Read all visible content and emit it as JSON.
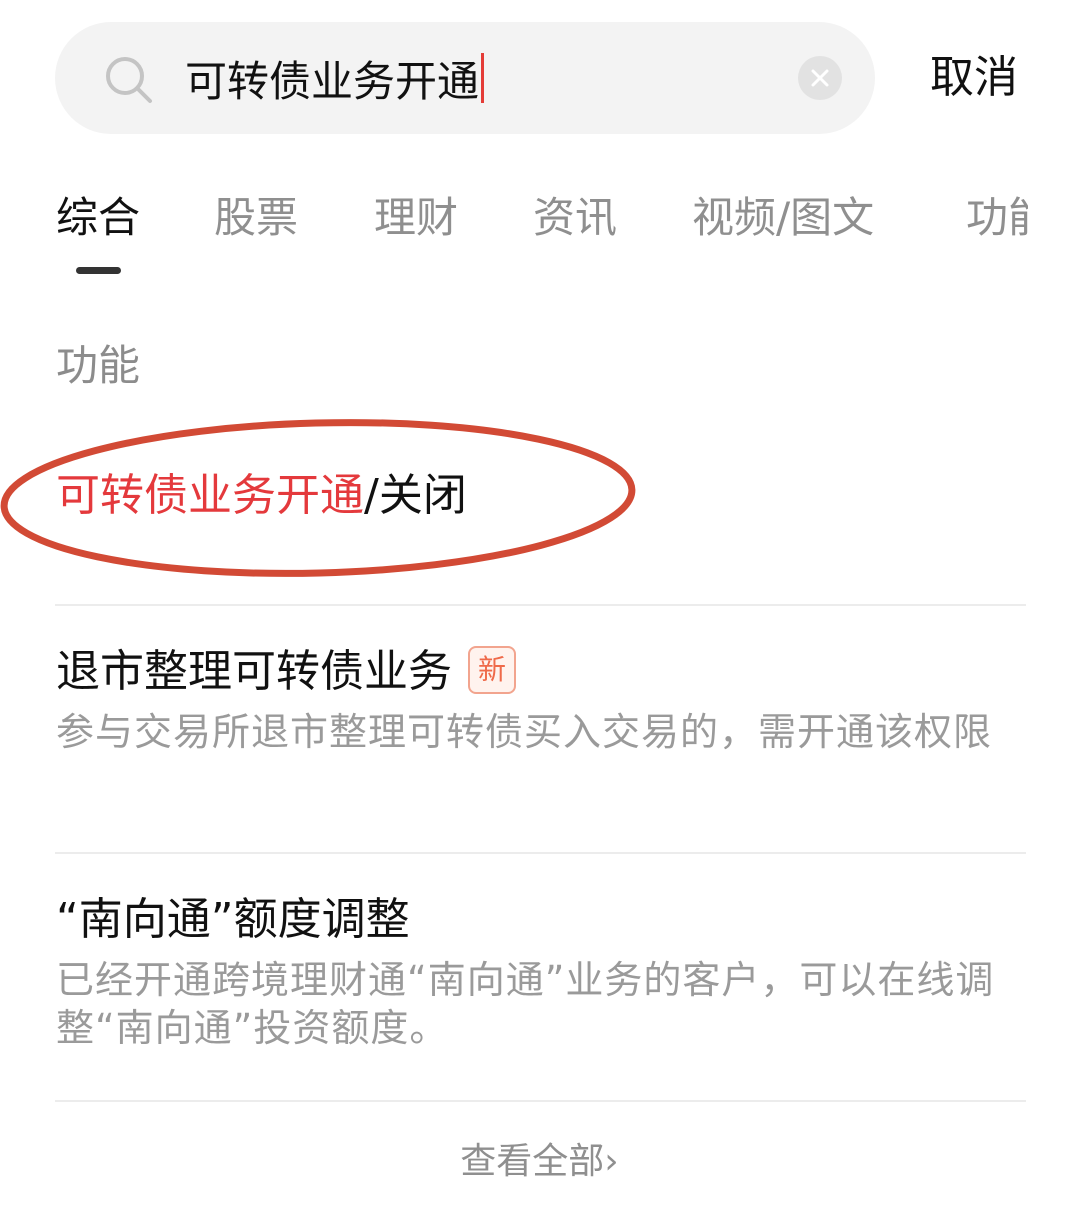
{
  "search": {
    "query": "可转债业务开通",
    "cancel_label": "取消"
  },
  "tabs": [
    {
      "label": "综合"
    },
    {
      "label": "股票"
    },
    {
      "label": "理财"
    },
    {
      "label": "资讯"
    },
    {
      "label": "视频/图文"
    },
    {
      "label": "功能"
    }
  ],
  "function_section": {
    "title": "功能",
    "top_result": {
      "highlight": "可转债业务开通",
      "suffix": "/关闭"
    }
  },
  "results": [
    {
      "title": "退市整理可转债业务",
      "badge": "新",
      "description": "参与交易所退市整理可转债买入交易的，需开通该权限"
    },
    {
      "title": "“南向通”额度调整",
      "description": "已经开通跨境理财通“南向通”业务的客户，可以在线调整“南向通”投资额度。"
    }
  ],
  "view_all": {
    "label": "查看全部",
    "arrow": "›"
  },
  "colors": {
    "highlight": "#e4393c",
    "annotation": "#d24a35",
    "badge": "#ef6a4a"
  }
}
